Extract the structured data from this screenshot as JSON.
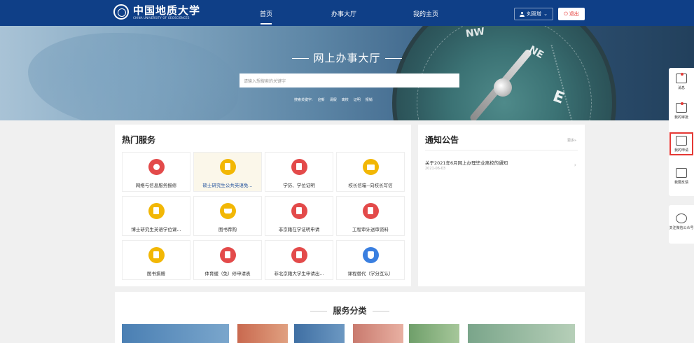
{
  "header": {
    "logo_text": "中国地质大学",
    "logo_subtext": "CHINA UNIVERSITY OF GEOSCIENCES",
    "nav": [
      {
        "label": "首页",
        "active": true
      },
      {
        "label": "办事大厅",
        "active": false
      },
      {
        "label": "我的主页",
        "active": false
      }
    ],
    "user_name": "刘双增",
    "logout_label": "退出"
  },
  "banner": {
    "title": "网上办事大厅",
    "search_placeholder": "请输入想搜索的关键字",
    "keywords_label": "搜索关键字:",
    "keywords": [
      "迎新",
      "请假",
      "离校",
      "证明",
      "报销"
    ]
  },
  "hot_services": {
    "title": "热门服务",
    "items": [
      {
        "label": "网络与信息服务报修",
        "icon": "compass-icon",
        "color": "#e34a4a"
      },
      {
        "label": "硕士研究生公共英语免...",
        "icon": "document-icon",
        "color": "#f2b705"
      },
      {
        "label": "学历、学位证明",
        "icon": "document-icon",
        "color": "#e34a4a"
      },
      {
        "label": "校长信箱--向校长写信",
        "icon": "mail-icon",
        "color": "#f2b705"
      },
      {
        "label": "博士研究生英语学位课...",
        "icon": "document-icon",
        "color": "#f2b705"
      },
      {
        "label": "图书荐购",
        "icon": "cart-icon",
        "color": "#f2b705"
      },
      {
        "label": "非京籍在学证明申请",
        "icon": "document-icon",
        "color": "#e34a4a"
      },
      {
        "label": "工程审计送审资料",
        "icon": "document-icon",
        "color": "#e34a4a"
      },
      {
        "label": "图书捐赠",
        "icon": "document-icon",
        "color": "#f2b705"
      },
      {
        "label": "体育缓（免）修申请表",
        "icon": "document-icon",
        "color": "#e34a4a"
      },
      {
        "label": "非北京籍大学生申请出...",
        "icon": "document-icon",
        "color": "#e34a4a"
      },
      {
        "label": "课程替代（学分互认）",
        "icon": "shield-icon",
        "color": "#3a7fe0"
      }
    ]
  },
  "notice": {
    "title": "通知公告",
    "more_label": "更多»",
    "items": [
      {
        "title": "关于2021年6月网上办理毕业离校的通知",
        "date": "2021-06-03"
      }
    ]
  },
  "categories": {
    "title": "服务分类"
  },
  "sidebar": {
    "items": [
      {
        "label": "消息",
        "icon": "message-icon"
      },
      {
        "label": "我的审批",
        "icon": "approval-icon"
      },
      {
        "label": "我的申请",
        "icon": "application-icon"
      },
      {
        "label": "我要反馈",
        "icon": "feedback-icon"
      },
      {
        "label": "关注微信公众号",
        "icon": "wechat-icon"
      }
    ]
  }
}
